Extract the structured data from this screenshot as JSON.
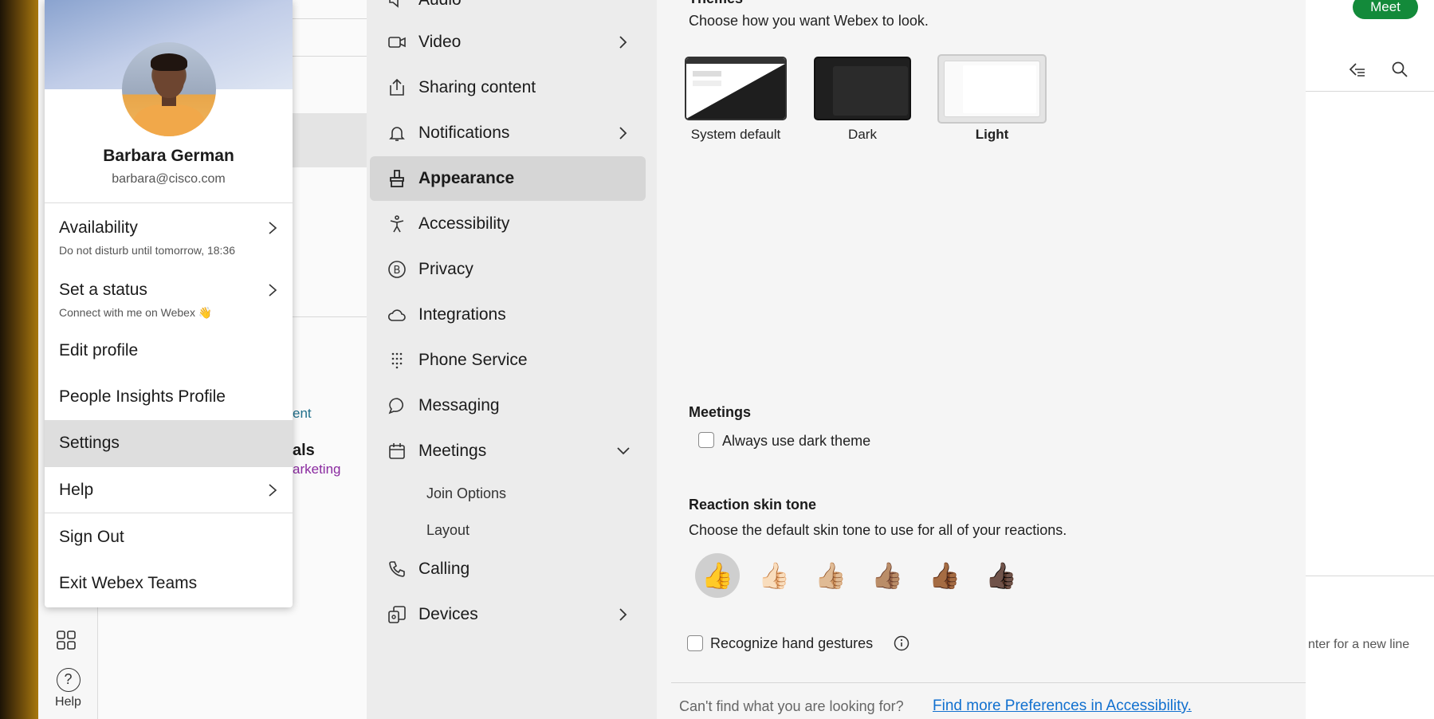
{
  "profile": {
    "name": "Barbara German",
    "email": "barbara@cisco.com",
    "menu": [
      {
        "label": "Availability",
        "sub": "Do not disturb until tomorrow, 18:36"
      },
      {
        "label": "Set a status",
        "sub": "Connect with me on Webex 👋"
      },
      {
        "label": "Edit profile"
      },
      {
        "label": "People Insights Profile"
      },
      {
        "label": "Settings"
      },
      {
        "label": "Help"
      },
      {
        "label": "Sign Out"
      },
      {
        "label": "Exit Webex Teams"
      }
    ]
  },
  "rail": {
    "help_label": "Help"
  },
  "background": {
    "frag1": "ent",
    "frag2": "als",
    "frag3": "arketing"
  },
  "settings_nav": {
    "items": [
      {
        "label": "Audio",
        "icon": "speaker-icon"
      },
      {
        "label": "Video",
        "icon": "video-icon"
      },
      {
        "label": "Sharing content",
        "icon": "share-icon"
      },
      {
        "label": "Notifications",
        "icon": "bell-icon"
      },
      {
        "label": "Appearance",
        "icon": "paintbrush-icon"
      },
      {
        "label": "Accessibility",
        "icon": "accessibility-icon"
      },
      {
        "label": "Privacy",
        "icon": "privacy-icon"
      },
      {
        "label": "Integrations",
        "icon": "cloud-icon"
      },
      {
        "label": "Phone Service",
        "icon": "dialpad-icon"
      },
      {
        "label": "Messaging",
        "icon": "chat-icon"
      },
      {
        "label": "Meetings",
        "icon": "calendar-icon"
      },
      {
        "label": "Calling",
        "icon": "phone-icon"
      },
      {
        "label": "Devices",
        "icon": "devices-icon"
      }
    ],
    "meetings_sub": [
      "Join Options",
      "Layout"
    ]
  },
  "appearance": {
    "themes_heading": "Themes",
    "themes_desc": "Choose how you want Webex to look.",
    "themes": [
      {
        "label": "System default",
        "selected": false
      },
      {
        "label": "Dark",
        "selected": false
      },
      {
        "label": "Light",
        "selected": true
      }
    ],
    "meetings_heading": "Meetings",
    "dark_theme_label": "Always use dark theme",
    "skin_heading": "Reaction skin tone",
    "skin_desc": "Choose the default skin tone to use for all of your reactions.",
    "skin_tones": [
      "👍",
      "👍🏻",
      "👍🏼",
      "👍🏽",
      "👍🏾",
      "👍🏿"
    ],
    "gestures_label": "Recognize hand gestures",
    "footer_text": "Can't find what you are looking for?",
    "footer_link": "Find more Preferences in Accessibility."
  },
  "right_panel": {
    "meet_label": "Meet",
    "hint_text": "nter for a new line"
  },
  "colors": {
    "accent_green": "#138a3a",
    "link_blue": "#1170cf",
    "selected_bg": "#d6d6d6"
  }
}
